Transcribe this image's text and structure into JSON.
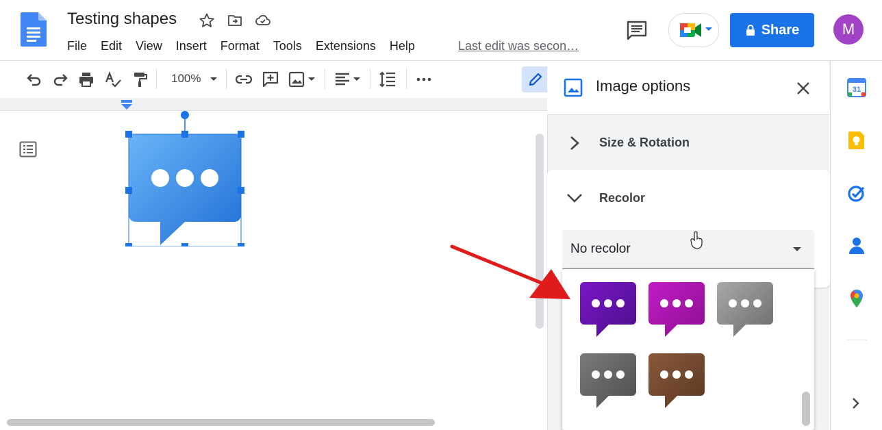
{
  "doc": {
    "title": "Testing shapes"
  },
  "menu": [
    "File",
    "Edit",
    "View",
    "Insert",
    "Format",
    "Tools",
    "Extensions",
    "Help"
  ],
  "last_edit": "Last edit was secon…",
  "share": {
    "label": "Share"
  },
  "avatar": {
    "initial": "M",
    "color": "#a142c7"
  },
  "toolbar": {
    "zoom": "100%"
  },
  "panel": {
    "title": "Image options",
    "sections": {
      "size_rotation": "Size & Rotation",
      "recolor": "Recolor"
    },
    "recolor_select": {
      "value": "No recolor"
    },
    "recolor_options": [
      {
        "name": "purple",
        "colors": [
          "#7b17c7",
          "#4a0f8a"
        ]
      },
      {
        "name": "magenta",
        "colors": [
          "#c21cc7",
          "#8c0f8f"
        ]
      },
      {
        "name": "light-gray",
        "colors": [
          "#a8a8a8",
          "#6b6b6b"
        ]
      },
      {
        "name": "dark-gray",
        "colors": [
          "#7a7a7a",
          "#4d4d4d"
        ]
      },
      {
        "name": "brown",
        "colors": [
          "#8a5a3c",
          "#5a3621"
        ]
      }
    ]
  },
  "colors": {
    "accent": "#1a73e8",
    "image_blue": "#4a9bf0",
    "arrow_red": "#e01b1b"
  }
}
